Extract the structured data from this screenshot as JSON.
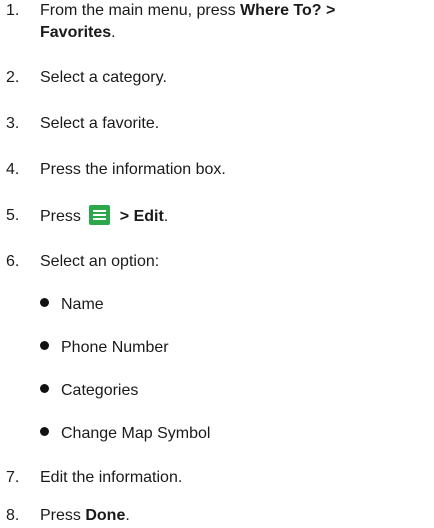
{
  "steps": [
    {
      "num": "1.",
      "pre": "From the main menu, press ",
      "b1": "Where To? >",
      "b2": "Favorites",
      "post": "."
    },
    {
      "num": "2.",
      "text": "Select a category."
    },
    {
      "num": "3.",
      "text": "Select a favorite."
    },
    {
      "num": "4.",
      "text": "Press the information box."
    },
    {
      "num": "5.",
      "pre": "Press ",
      "icon": "menu-icon",
      "bold": " > Edit",
      "post": "."
    },
    {
      "num": "6.",
      "text": "Select an option:"
    },
    {
      "num": "7.",
      "text": "Edit the information."
    },
    {
      "num": "8.",
      "pre": "Press ",
      "bold": "Done",
      "post": "."
    }
  ],
  "options": [
    "Name",
    "Phone Number",
    "Categories",
    "Change Map Symbol"
  ],
  "colors": {
    "menu_icon": "#2aa84a"
  }
}
